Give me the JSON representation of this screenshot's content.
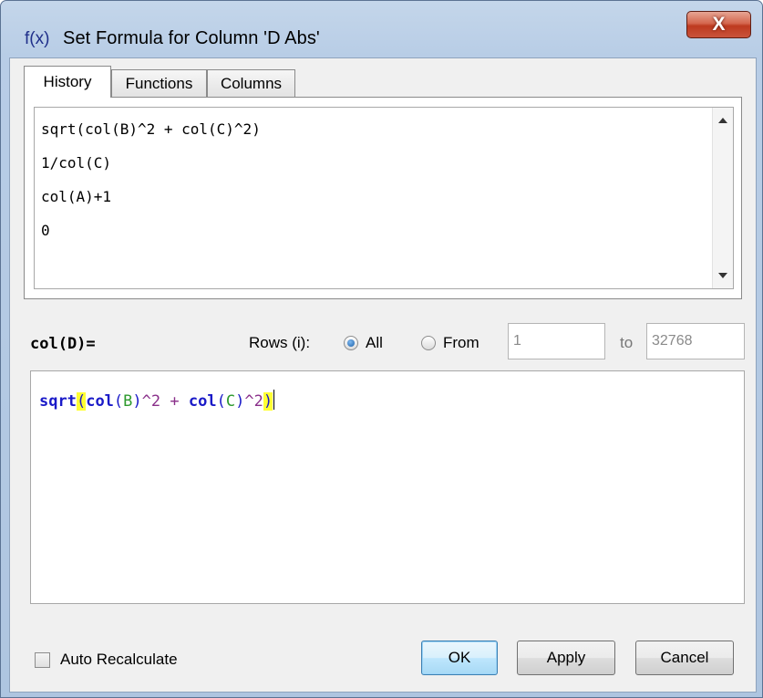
{
  "window": {
    "title_icon": "f(x)",
    "title": "Set Formula for Column 'D Abs'",
    "close_label": "X"
  },
  "tabs": [
    {
      "label": "History",
      "active": true
    },
    {
      "label": "Functions",
      "active": false
    },
    {
      "label": "Columns",
      "active": false
    }
  ],
  "history": {
    "items": [
      "sqrt(col(B)^2 + col(C)^2)",
      "1/col(C)",
      "col(A)+1",
      "0"
    ]
  },
  "formula_target": "col(D)=",
  "rows": {
    "label": "Rows (i):",
    "all_label": "All",
    "from_label": "From",
    "selected": "All",
    "from_value": "1",
    "to_label": "to",
    "to_value": "32768"
  },
  "editor": {
    "formula_text": "sqrt(col(B)^2 + col(C)^2)",
    "tokens": [
      {
        "t": "sqrt",
        "c": "tok-func"
      },
      {
        "t": "(",
        "c": "tok-par tok-hl"
      },
      {
        "t": "col",
        "c": "tok-func"
      },
      {
        "t": "(",
        "c": "tok-par"
      },
      {
        "t": "B",
        "c": "tok-arg"
      },
      {
        "t": ")",
        "c": "tok-par"
      },
      {
        "t": "^2",
        "c": "tok-op"
      },
      {
        "t": " + ",
        "c": "tok-op"
      },
      {
        "t": "col",
        "c": "tok-func"
      },
      {
        "t": "(",
        "c": "tok-par"
      },
      {
        "t": "C",
        "c": "tok-arg"
      },
      {
        "t": ")",
        "c": "tok-par"
      },
      {
        "t": "^2",
        "c": "tok-op"
      },
      {
        "t": ")",
        "c": "tok-par tok-hl"
      }
    ]
  },
  "footer": {
    "auto_recalc_label": "Auto Recalculate",
    "auto_recalc_checked": false,
    "ok_label": "OK",
    "apply_label": "Apply",
    "cancel_label": "Cancel"
  },
  "colors": {
    "function": "#1a1ac8",
    "argument": "#2e9a2e",
    "operator": "#8a2f8a",
    "bracket_highlight": "#ffff33",
    "close_button": "#c9533b"
  },
  "icons": [
    "fx-icon",
    "close-icon",
    "scroll-up-icon",
    "scroll-down-icon",
    "radio-icon",
    "checkbox-icon"
  ]
}
